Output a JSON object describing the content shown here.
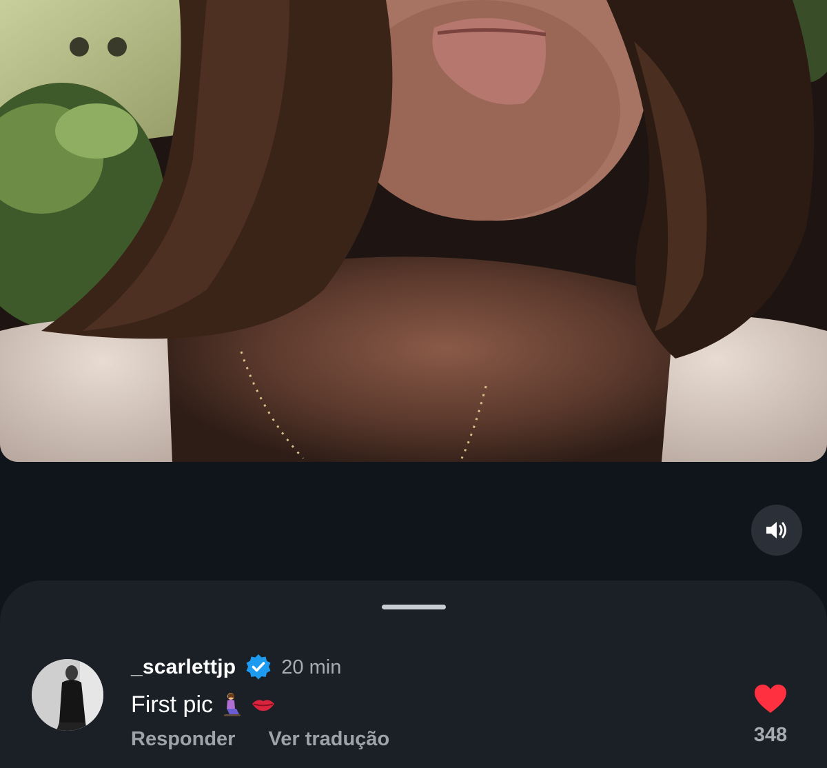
{
  "media": {
    "description_icon": "photo"
  },
  "controls": {
    "mute_icon": "speaker-icon"
  },
  "comment": {
    "username": "_scarlettjp",
    "verified": true,
    "time": "20 min",
    "text": "First pic",
    "emojis": [
      "woman-kneeling-emoji",
      "lips-emoji"
    ],
    "reply_label": "Responder",
    "translate_label": "Ver tradução",
    "like_icon": "heart-icon",
    "like_count": "348"
  },
  "colors": {
    "background": "#10141b",
    "sheet": "#1b1f26",
    "verified_badge": "#1d9bf0",
    "heart": "#ff3040",
    "muted_text": "#a7acb4"
  }
}
